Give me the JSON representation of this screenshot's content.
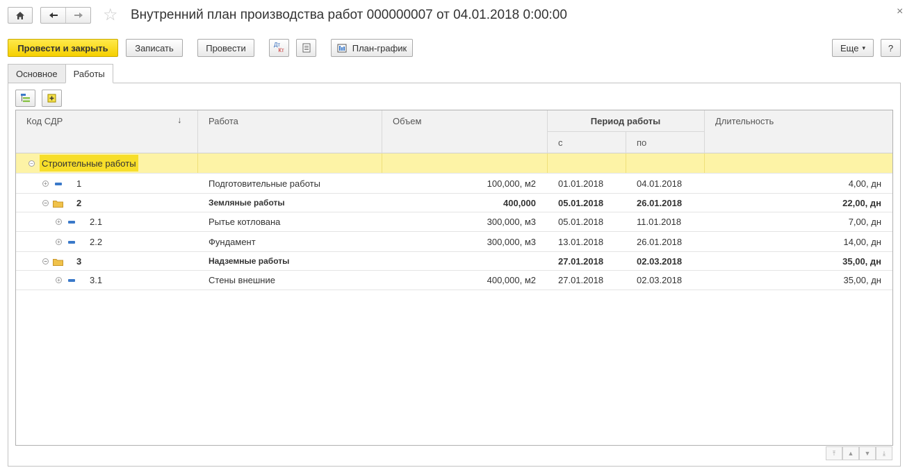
{
  "window": {
    "title": "Внутренний план производства работ 000000007 от 04.01.2018 0:00:00",
    "home_icon": "home-icon",
    "back_icon": "arrow-left-icon",
    "forward_icon": "arrow-right-icon",
    "favorite_icon": "star-icon",
    "close_glyph": "×"
  },
  "toolbar": {
    "post_and_close": "Провести и закрыть",
    "save": "Записать",
    "post": "Провести",
    "dtkt_top": "Дт",
    "dtkt_bottom": "Кт",
    "schedule": "План-график",
    "more": "Еще",
    "more_arrow": "▾",
    "help": "?"
  },
  "tabs": [
    {
      "label": "Основное",
      "active": false
    },
    {
      "label": "Работы",
      "active": true
    }
  ],
  "table": {
    "sort_arrow": "↓",
    "headers": {
      "code": "Код СДР",
      "work": "Работа",
      "volume": "Объем",
      "period": "Период работы",
      "from": "с",
      "to": "по",
      "duration": "Длительность"
    },
    "rows": [
      {
        "code": "Строительные работы",
        "work": "",
        "volume": "",
        "from": "",
        "to": "",
        "duration": "",
        "level": 0,
        "kind": "root",
        "bold": false
      },
      {
        "code": "1",
        "work": "Подготовительные работы",
        "volume": "100,000, м2",
        "from": "01.01.2018",
        "to": "04.01.2018",
        "duration": "4,00, дн",
        "level": 1,
        "kind": "leaf",
        "bold": false
      },
      {
        "code": "2",
        "work": "Земляные работы",
        "volume": "400,000",
        "from": "05.01.2018",
        "to": "26.01.2018",
        "duration": "22,00, дн",
        "level": 1,
        "kind": "group",
        "bold": true
      },
      {
        "code": "2.1",
        "work": "Рытье котлована",
        "volume": "300,000, м3",
        "from": "05.01.2018",
        "to": "11.01.2018",
        "duration": "7,00, дн",
        "level": 2,
        "kind": "leaf",
        "bold": false
      },
      {
        "code": "2.2",
        "work": "Фундамент",
        "volume": "300,000, м3",
        "from": "13.01.2018",
        "to": "26.01.2018",
        "duration": "14,00, дн",
        "level": 2,
        "kind": "leaf",
        "bold": false
      },
      {
        "code": "3",
        "work": "Надземные работы",
        "volume": "",
        "from": "27.01.2018",
        "to": "02.03.2018",
        "duration": "35,00, дн",
        "level": 1,
        "kind": "group",
        "bold": true
      },
      {
        "code": "3.1",
        "work": "Стены внешние",
        "volume": "400,000, м2",
        "from": "27.01.2018",
        "to": "02.03.2018",
        "duration": "35,00, дн",
        "level": 2,
        "kind": "leaf",
        "bold": false
      }
    ]
  },
  "colors": {
    "accent_yellow": "#f5cf00",
    "selection": "#fdf3a6",
    "leaf_icon": "#3a79c9",
    "folder_icon": "#f0c24a"
  }
}
